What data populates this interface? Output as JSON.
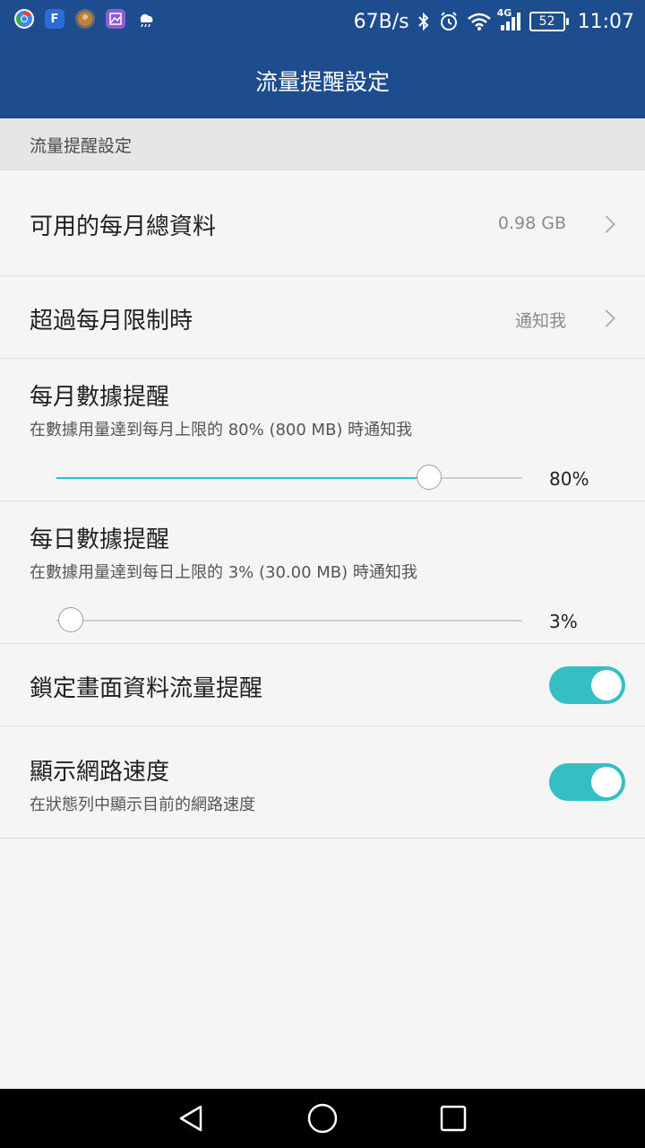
{
  "status_bar": {
    "speed": "67B/s",
    "network": "4G",
    "battery": "52",
    "time": "11:07",
    "icons": [
      "chrome-icon",
      "facebook-icon",
      "photo-app-icon",
      "gallery-icon",
      "weather-icon",
      "bluetooth-icon",
      "alarm-icon",
      "wifi-icon",
      "cell-signal-icon",
      "battery-icon"
    ]
  },
  "app_bar": {
    "title": "流量提醒設定"
  },
  "section": {
    "header": "流量提醒設定"
  },
  "rows": {
    "monthly_total": {
      "title": "可用的每月總資料",
      "value": "0.98 GB"
    },
    "over_limit": {
      "title": "超過每月限制時",
      "value": "通知我"
    },
    "monthly_alert": {
      "title": "每月數據提醒",
      "subtitle": "在數據用量達到每月上限的 80% (800 MB) 時通知我",
      "percent_label": "80%",
      "slider_value": 0.8
    },
    "daily_alert": {
      "title": "每日數據提醒",
      "subtitle": "在數據用量達到每日上限的 3% (30.00 MB) 時通知我",
      "percent_label": "3%",
      "slider_value": 0.03
    },
    "lockscreen_alert": {
      "title": "鎖定畫面資料流量提醒",
      "enabled": true
    },
    "show_speed": {
      "title": "顯示網路速度",
      "subtitle": "在狀態列中顯示目前的網路速度",
      "enabled": true
    }
  },
  "colors": {
    "primary": "#1e4d8f",
    "accent": "#35bfc4",
    "background": "#f5f5f5"
  }
}
